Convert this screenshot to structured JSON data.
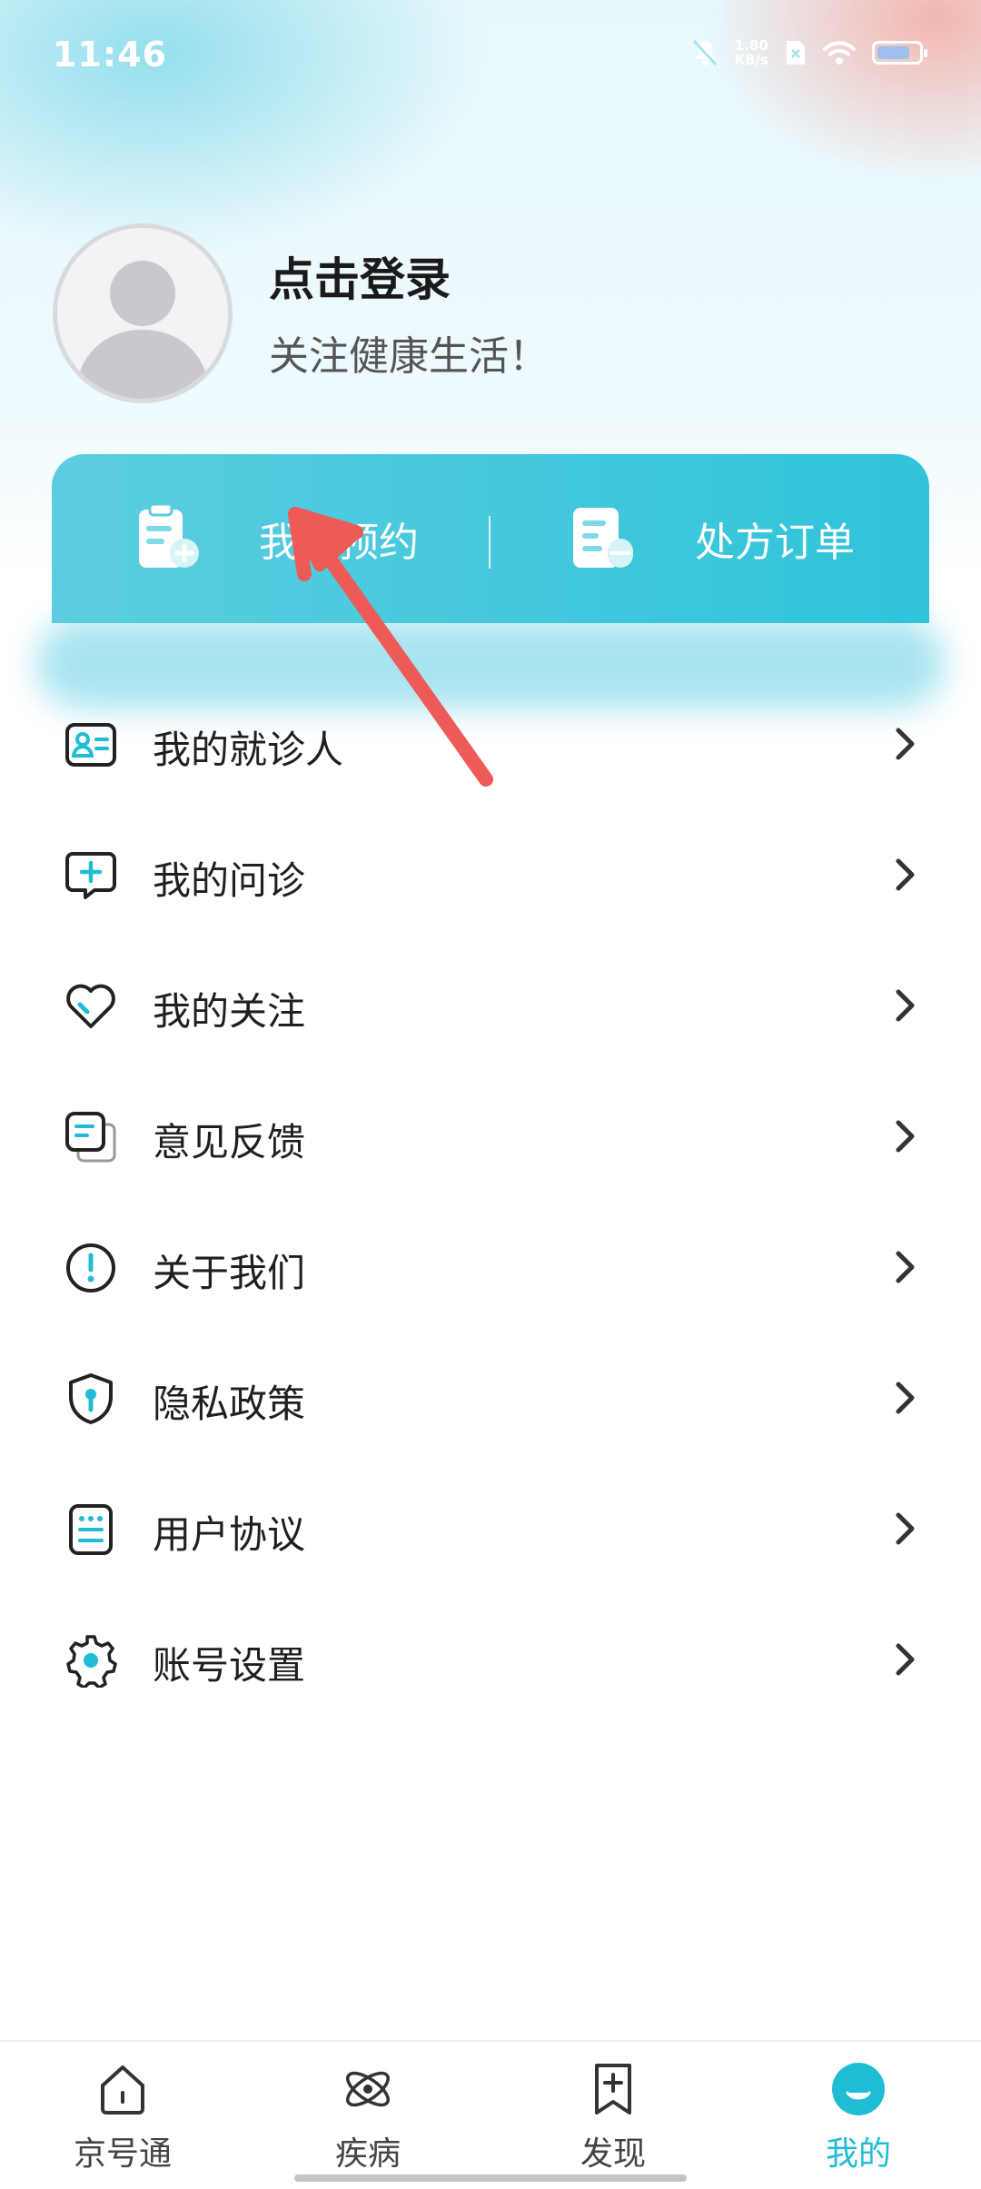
{
  "status_bar": {
    "time": "11:46",
    "net_speed_value": "1.80",
    "net_speed_unit": "KB/s",
    "battery_level": 0.8
  },
  "profile": {
    "login_label": "点击登录",
    "slogan": "关注健康生活！"
  },
  "quick_actions": [
    {
      "label": "我的预约",
      "icon": "clipboard-plus-icon"
    },
    {
      "label": "处方订单",
      "icon": "prescription-icon"
    }
  ],
  "menu": [
    {
      "label": "我的就诊人",
      "icon": "patient-card-icon"
    },
    {
      "label": "我的问诊",
      "icon": "chat-plus-icon"
    },
    {
      "label": "我的关注",
      "icon": "heart-icon"
    },
    {
      "label": "意见反馈",
      "icon": "feedback-icon"
    },
    {
      "label": "关于我们",
      "icon": "info-exclamation-icon"
    },
    {
      "label": "隐私政策",
      "icon": "shield-icon"
    },
    {
      "label": "用户协议",
      "icon": "agreement-icon"
    },
    {
      "label": "账号设置",
      "icon": "gear-icon"
    }
  ],
  "bottom_nav": [
    {
      "label": "京号通",
      "icon": "home-icon"
    },
    {
      "label": "疾病",
      "icon": "atom-icon"
    },
    {
      "label": "发现",
      "icon": "bookmark-plus-icon"
    },
    {
      "label": "我的",
      "icon": "profile-face-icon",
      "active": true
    }
  ],
  "colors": {
    "accent": "#20bcd6",
    "card_gradient_start": "#5ccde0",
    "card_gradient_end": "#2fc3d9",
    "annotation_arrow": "#ee5a57"
  }
}
